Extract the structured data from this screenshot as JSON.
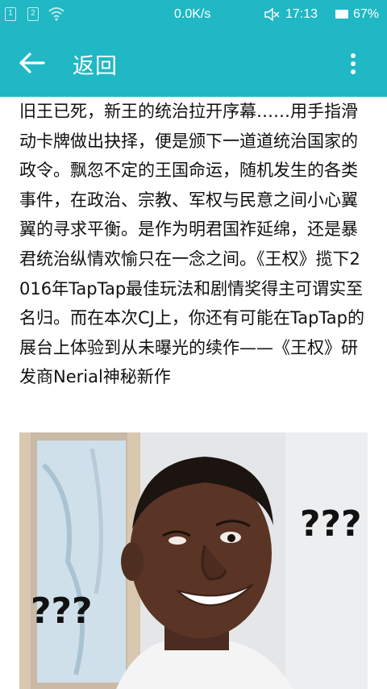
{
  "status_bar": {
    "sim1_label": "1",
    "sim2_label": "2",
    "network_speed": "0.0K/s",
    "time": "17:13",
    "battery": "67%",
    "icons": [
      "sim-1-icon",
      "sim-2-icon",
      "wifi-icon",
      "mute-icon",
      "battery-icon"
    ]
  },
  "app_bar": {
    "back_icon": "arrow-left-icon",
    "title": "返回",
    "menu_icon": "more-vert-icon",
    "background": "#1fb8c4"
  },
  "article": {
    "paragraph": "旧王已死，新王的统治拉开序幕……用手指滑动卡牌做出抉择，便是颁下一道道统治国家的政令。飘忽不定的王国命运，随机发生的各类事件，在政治、宗教、军权与民意之间小心翼翼的寻求平衡。是作为明君国祚延绵，还是暴君统治纵情欢愉只在一念之间。《王权》揽下2016年TapTap最佳玩法和剧情奖得主可谓实至名归。而在本次CJ上，你还有可能在TapTap的展台上体验到从未曝光的续作——《王权》研发商Nerial神秘新作",
    "image": {
      "caption_marks": [
        "???",
        "???"
      ],
      "description_icon": "meme-photo"
    }
  }
}
